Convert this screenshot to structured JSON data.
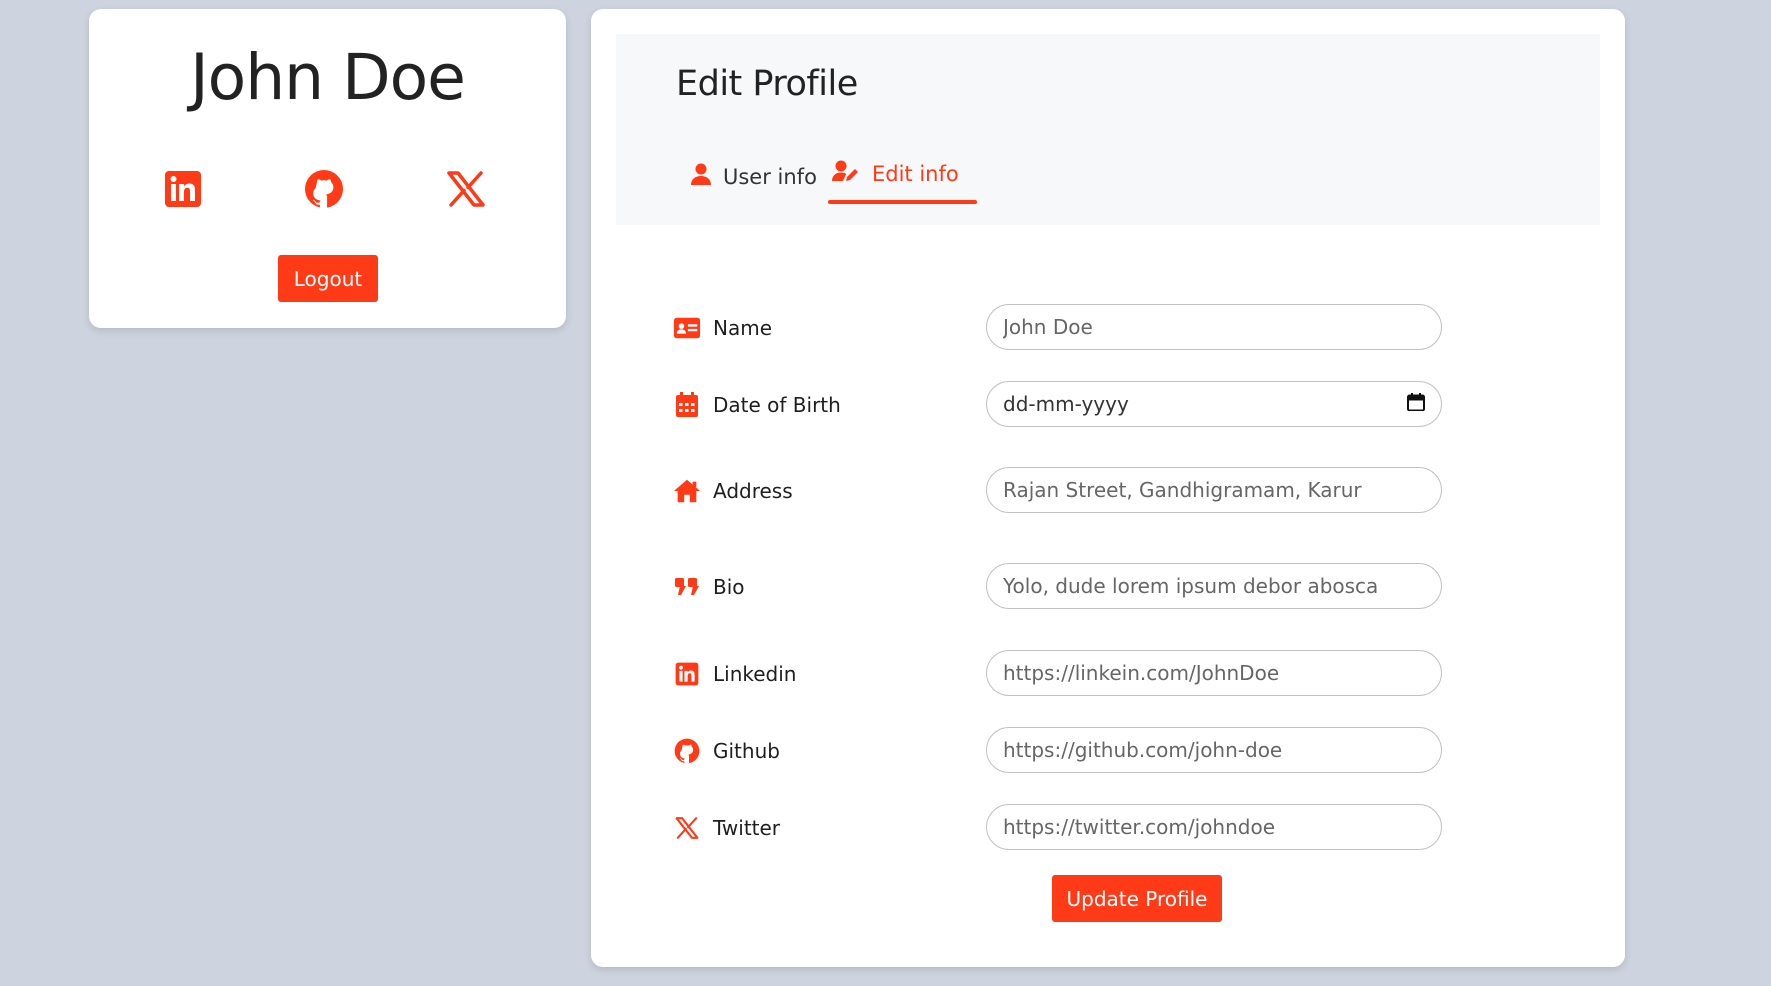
{
  "profile": {
    "name": "John Doe",
    "logout_label": "Logout",
    "social_icons": [
      "linkedin-icon",
      "github-icon",
      "x-icon"
    ]
  },
  "edit": {
    "title": "Edit Profile",
    "tabs": [
      {
        "label": "User info",
        "icon": "user-icon",
        "active": false
      },
      {
        "label": "Edit info",
        "icon": "user-pen-icon",
        "active": true
      }
    ],
    "fields": {
      "name": {
        "label": "Name",
        "icon": "id-card-icon",
        "placeholder": "John Doe"
      },
      "dob": {
        "label": "Date of Birth",
        "icon": "calendar-icon",
        "value": "dd-mm-yyyy"
      },
      "address": {
        "label": "Address",
        "icon": "house-icon",
        "placeholder": "Rajan Street, Gandhigramam, Karur"
      },
      "bio": {
        "label": "Bio",
        "icon": "quote-icon",
        "placeholder": "Yolo, dude lorem ipsum debor abosca"
      },
      "linkedin": {
        "label": "Linkedin",
        "icon": "linkedin-icon",
        "placeholder": "https://linkein.com/JohnDoe"
      },
      "github": {
        "label": "Github",
        "icon": "github-icon",
        "placeholder": "https://github.com/john-doe"
      },
      "twitter": {
        "label": "Twitter",
        "icon": "x-icon",
        "placeholder": "https://twitter.com/johndoe"
      }
    },
    "update_label": "Update Profile"
  },
  "colors": {
    "accent": "#ff3a17",
    "background": "#cdd4df",
    "card": "#ffffff",
    "header_panel": "#f7f8f9"
  }
}
